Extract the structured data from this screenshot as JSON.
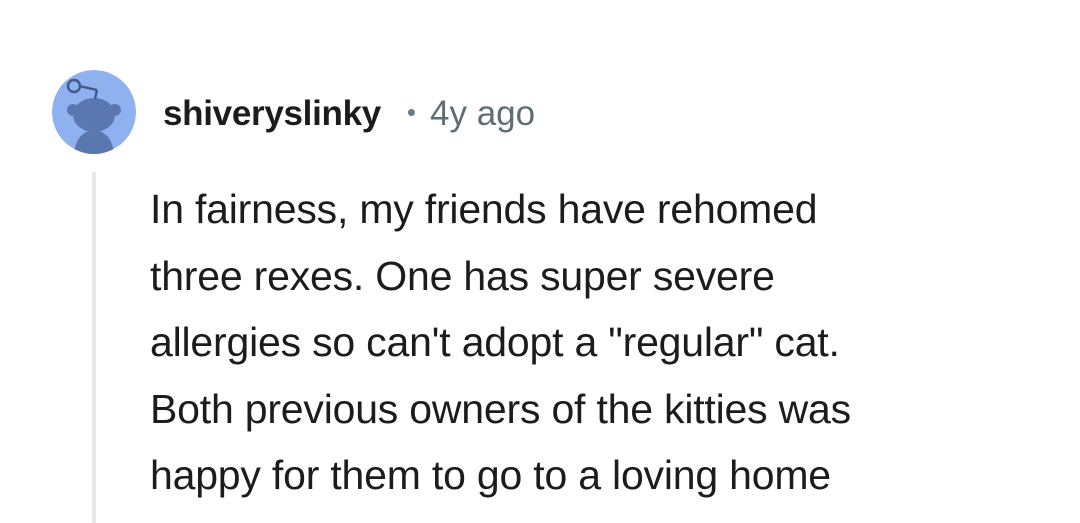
{
  "comment": {
    "author": "shiveryslinky",
    "separator": "•",
    "timestamp": "4y ago",
    "body": "In fairness, my friends have rehomed\nthree rexes. One has super severe\nallergies so can't adopt a \"regular\" cat.\nBoth previous owners of the kitties was\nhappy for them to go to a loving home",
    "avatar_icon": "snoo-avatar-icon"
  },
  "colors": {
    "avatar_background": "#8fb1f0",
    "avatar_figure": "#5b77b0",
    "thread_line": "#e6e9eb",
    "text": "#1c1c1c",
    "meta_text": "#5f6d75"
  }
}
